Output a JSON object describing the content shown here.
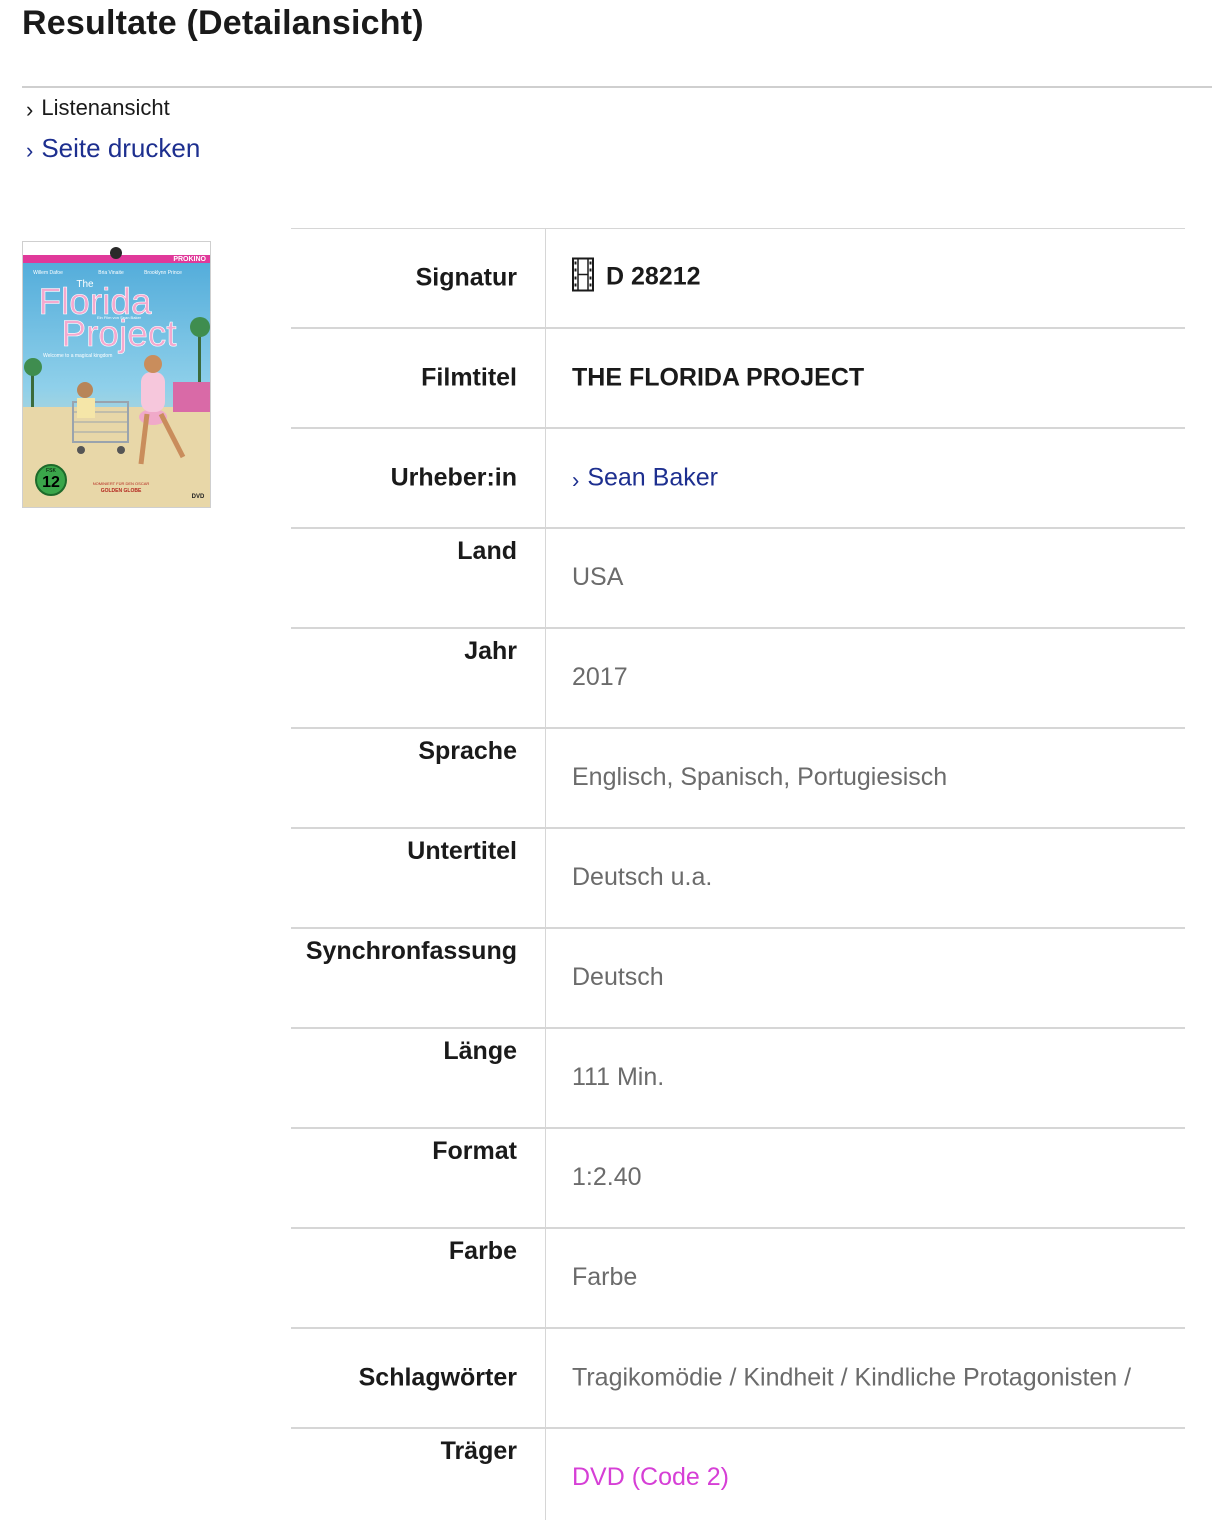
{
  "page": {
    "title": "Resultate (Detailansicht)"
  },
  "nav": {
    "list_view_label": "Listenansicht",
    "print_label": "Seite drucken"
  },
  "cover": {
    "brand": "PROKINO",
    "cast": [
      "Willem Dafoe",
      "Bria Vinaite",
      "Brooklynn Prince"
    ],
    "title_line1": "The",
    "title_line2": "Florida",
    "title_line3": "Project",
    "director_credit": "Ein Film von Sean Baker",
    "tagline": "Welcome to a magical kingdom",
    "fsk_top": "FSK",
    "fsk_age": "12",
    "award_line1": "NOMINIERT FÜR DEN OSCAR",
    "award_line2": "GOLDEN GLOBE",
    "media": "DVD"
  },
  "details": {
    "signatur": {
      "label": "Signatur",
      "value": "D 28212",
      "icon": "film-icon"
    },
    "filmtitel": {
      "label": "Filmtitel",
      "value": "THE FLORIDA PROJECT"
    },
    "urheber": {
      "label": "Urheber:in",
      "value": "Sean Baker"
    },
    "land": {
      "label": "Land",
      "value": "USA"
    },
    "jahr": {
      "label": "Jahr",
      "value": "2017"
    },
    "sprache": {
      "label": "Sprache",
      "value": "Englisch, Spanisch, Portugiesisch"
    },
    "untertitel": {
      "label": "Untertitel",
      "value": "Deutsch u.a."
    },
    "synchronfassung": {
      "label": "Synchronfassung",
      "value": "Deutsch"
    },
    "laenge": {
      "label": "Länge",
      "value": "111 Min."
    },
    "format": {
      "label": "Format",
      "value": "1:2.40"
    },
    "farbe": {
      "label": "Farbe",
      "value": "Farbe"
    },
    "schlagwoerter": {
      "label": "Schlagwörter",
      "value": "Tragikomödie / Kindheit / Kindliche Protagonisten /"
    },
    "traeger": {
      "label": "Träger",
      "value": "DVD (Code 2)"
    }
  },
  "colors": {
    "link": "#1d2f8f",
    "medium_link": "#d63fd6",
    "muted_text": "#6b6b6b",
    "rule": "#d6d6d6"
  }
}
